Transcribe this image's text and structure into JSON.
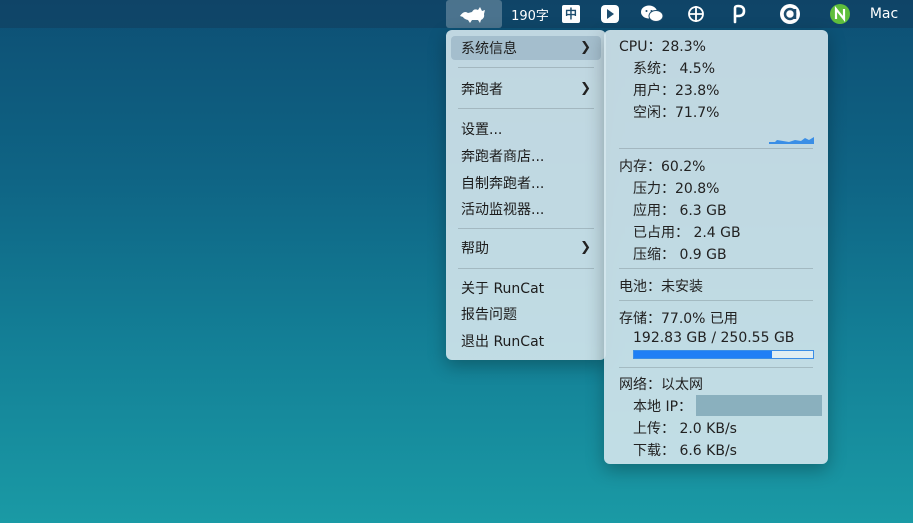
{
  "menubar": {
    "char_count": "190字",
    "input_method": "中",
    "app_label": "Mac",
    "icons": [
      "cat-icon",
      "arrow-app-icon",
      "wechat-icon",
      "tracking-icon",
      "p-icon",
      "a-circle-icon",
      "n-circle-icon"
    ]
  },
  "menu": {
    "items": [
      {
        "label": "系统信息",
        "has_submenu": true
      },
      {
        "label": "奔跑者",
        "has_submenu": true
      },
      {
        "label": "设置..."
      },
      {
        "label": "奔跑者商店..."
      },
      {
        "label": "自制奔跑者..."
      },
      {
        "label": "活动监视器..."
      },
      {
        "label": "帮助",
        "has_submenu": true
      },
      {
        "label": "关于 RunCat"
      },
      {
        "label": "报告问题"
      },
      {
        "label": "退出 RunCat"
      }
    ]
  },
  "info": {
    "cpu": "CPU：28.3%",
    "cpu_system": "系统：  4.5%",
    "cpu_user": "用户：23.8%",
    "cpu_idle": "空闲：71.7%",
    "memory": "内存：60.2%",
    "mem_pressure": "压力：20.8%",
    "mem_app": "应用：  6.3 GB",
    "mem_used": "已占用：  2.4 GB",
    "mem_compressed": "压缩：  0.9 GB",
    "battery": "电池：未安装",
    "storage": "存储：77.0% 已用",
    "storage_detail": "192.83 GB / 250.55 GB",
    "storage_used_percent": 77.0,
    "network": "网络：以太网",
    "local_ip_label": "本地 IP：",
    "upload": "上传：  2.0 KB/s",
    "download": "下载：  6.6 KB/s"
  },
  "colors": {
    "accent": "#1f7ff5",
    "highlight": "#8caabe"
  }
}
